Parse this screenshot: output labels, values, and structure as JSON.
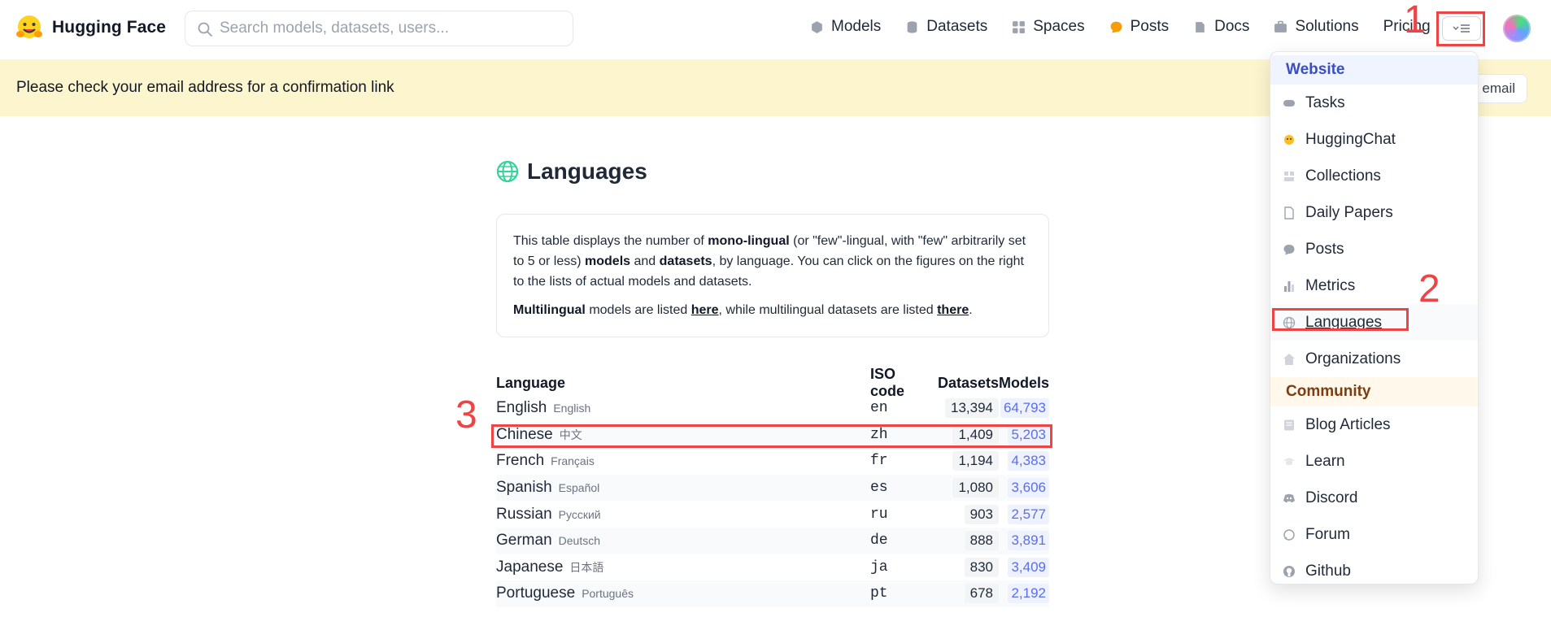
{
  "header": {
    "brand": "Hugging Face",
    "search_placeholder": "Search models, datasets, users...",
    "nav": [
      {
        "label": "Models",
        "icon": "models-icon"
      },
      {
        "label": "Datasets",
        "icon": "datasets-icon"
      },
      {
        "label": "Spaces",
        "icon": "spaces-icon"
      },
      {
        "label": "Posts",
        "icon": "posts-icon"
      },
      {
        "label": "Docs",
        "icon": "docs-icon"
      },
      {
        "label": "Solutions",
        "icon": "solutions-icon"
      },
      {
        "label": "Pricing"
      }
    ]
  },
  "banner": {
    "text": "Please check your email address for a confirmation link",
    "button_label": "email"
  },
  "main": {
    "title": "Languages",
    "info": {
      "p1_a": "This table displays the number of ",
      "p1_b": "mono-lingual",
      "p1_c": " (or \"few\"-lingual, with \"few\" arbitrarily set to 5 or less) ",
      "p1_d": "models",
      "p1_e": " and ",
      "p1_f": "datasets",
      "p1_g": ", by language. You can click on the figures on the right to the lists of actual models and datasets.",
      "p2_a": "Multilingual",
      "p2_b": " models are listed ",
      "p2_c": "here",
      "p2_d": ", while multilingual datasets are listed ",
      "p2_e": "there",
      "p2_f": "."
    },
    "table": {
      "headers": {
        "language": "Language",
        "iso": "ISO code",
        "datasets": "Datasets",
        "models": "Models"
      },
      "rows": [
        {
          "name": "English",
          "native": "English",
          "iso": "en",
          "datasets": "13,394",
          "models": "64,793"
        },
        {
          "name": "Chinese",
          "native": "中文",
          "iso": "zh",
          "datasets": "1,409",
          "models": "5,203"
        },
        {
          "name": "French",
          "native": "Français",
          "iso": "fr",
          "datasets": "1,194",
          "models": "4,383"
        },
        {
          "name": "Spanish",
          "native": "Español",
          "iso": "es",
          "datasets": "1,080",
          "models": "3,606"
        },
        {
          "name": "Russian",
          "native": "Русский",
          "iso": "ru",
          "datasets": "903",
          "models": "2,577"
        },
        {
          "name": "German",
          "native": "Deutsch",
          "iso": "de",
          "datasets": "888",
          "models": "3,891"
        },
        {
          "name": "Japanese",
          "native": "日本語",
          "iso": "ja",
          "datasets": "830",
          "models": "3,409"
        },
        {
          "name": "Portuguese",
          "native": "Português",
          "iso": "pt",
          "datasets": "678",
          "models": "2,192"
        }
      ]
    }
  },
  "dropdown": {
    "website_label": "Website",
    "website_items": [
      {
        "label": "Tasks",
        "icon": "tasks-icon"
      },
      {
        "label": "HuggingChat",
        "icon": "huggingchat-icon"
      },
      {
        "label": "Collections",
        "icon": "collections-icon"
      },
      {
        "label": "Daily Papers",
        "icon": "daily-papers-icon"
      },
      {
        "label": "Posts",
        "icon": "posts-icon"
      },
      {
        "label": "Metrics",
        "icon": "metrics-icon"
      },
      {
        "label": "Languages",
        "icon": "globe-icon"
      },
      {
        "label": "Organizations",
        "icon": "organizations-icon"
      }
    ],
    "community_label": "Community",
    "community_items": [
      {
        "label": "Blog Articles",
        "icon": "blog-icon"
      },
      {
        "label": "Learn",
        "icon": "learn-icon"
      },
      {
        "label": "Discord",
        "icon": "discord-icon"
      },
      {
        "label": "Forum",
        "icon": "forum-icon"
      },
      {
        "label": "Github",
        "icon": "github-icon"
      }
    ]
  },
  "annotations": {
    "n1": "1",
    "n2": "2",
    "n3": "3"
  },
  "colors": {
    "annotation": "#ef4444",
    "banner": "#fdf5cd",
    "link_blue": "#5b6ee8"
  }
}
